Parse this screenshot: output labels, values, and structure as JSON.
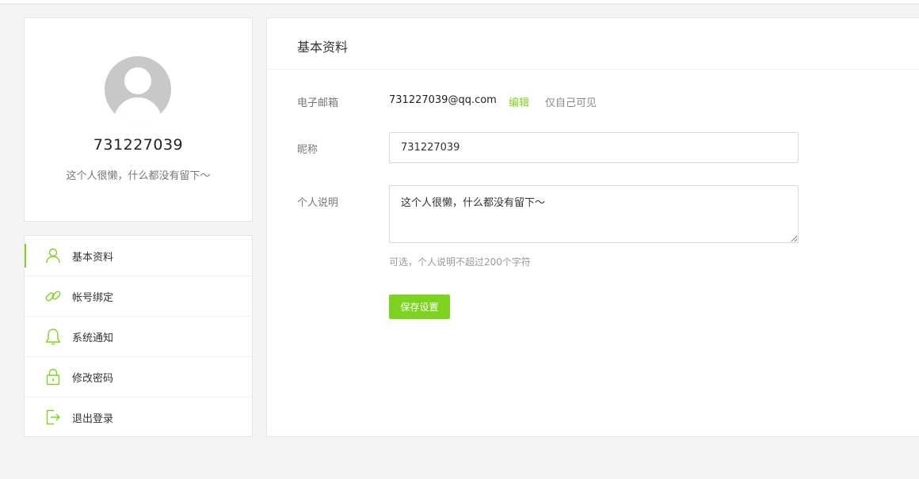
{
  "profile": {
    "username": "731227039",
    "bio": "这个人很懒，什么都没有留下～"
  },
  "menu": {
    "accent_color": "#7ed321",
    "items": [
      {
        "label": "基本资料",
        "icon": "user-icon",
        "active": true
      },
      {
        "label": "帐号绑定",
        "icon": "link-icon",
        "active": false
      },
      {
        "label": "系统通知",
        "icon": "bell-icon",
        "active": false
      },
      {
        "label": "修改密码",
        "icon": "lock-icon",
        "active": false
      },
      {
        "label": "退出登录",
        "icon": "logout-icon",
        "active": false
      }
    ]
  },
  "main": {
    "title": "基本资料",
    "email": {
      "label": "电子邮箱",
      "value": "731227039@qq.com",
      "edit_label": "编辑",
      "visibility": "仅自己可见"
    },
    "nickname": {
      "label": "昵称",
      "value": "731227039"
    },
    "description": {
      "label": "个人说明",
      "value": "这个人很懒，什么都没有留下～",
      "hint": "可选，个人说明不超过200个字符"
    },
    "save_label": "保存设置"
  }
}
